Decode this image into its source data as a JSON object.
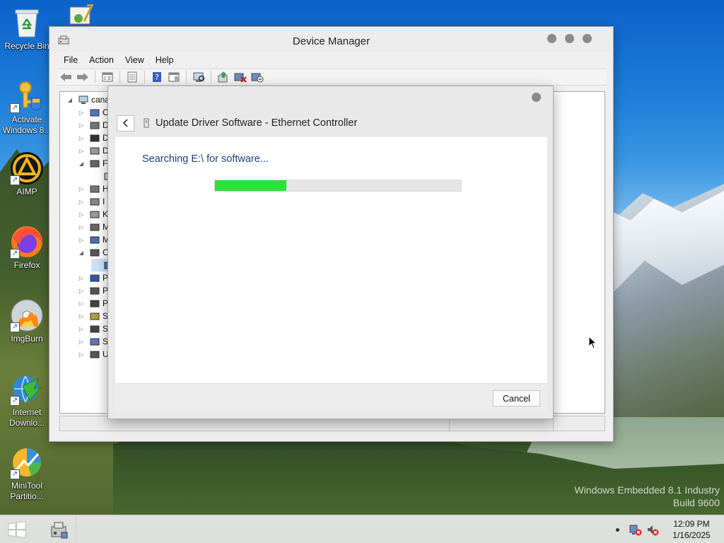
{
  "desktop": {
    "icons": [
      {
        "name": "recycle-bin-icon",
        "label": "Recycle Bin"
      },
      {
        "name": "activate-windows-icon",
        "label": "Activate Windows 8..."
      },
      {
        "name": "aimp-icon",
        "label": "AIMP"
      },
      {
        "name": "firefox-icon",
        "label": "Firefox"
      },
      {
        "name": "imgburn-icon",
        "label": "ImgBurn"
      },
      {
        "name": "internet-download-icon",
        "label": "Internet Downlo..."
      },
      {
        "name": "minitool-partition-icon",
        "label": "MiniTool Partitio..."
      }
    ],
    "watermark": {
      "line1": "Windows Embedded 8.1 Industry",
      "line2": "Build 9600"
    }
  },
  "device_manager": {
    "title": "Device Manager",
    "menu": [
      "File",
      "Action",
      "View",
      "Help"
    ],
    "toolbar": [
      "back-icon",
      "forward-icon",
      "properties-icon",
      "show-hide-icon",
      "help-icon",
      "action-view-icon",
      "scan-hardware-icon",
      "update-driver-icon",
      "uninstall-icon",
      "disable-icon"
    ],
    "tree": {
      "root": "cana",
      "items": [
        {
          "expand": "collapsed",
          "icon": "computer-icon",
          "label": "C"
        },
        {
          "expand": "collapsed",
          "icon": "disk-icon",
          "label": "D"
        },
        {
          "expand": "collapsed",
          "icon": "display-icon",
          "label": "D"
        },
        {
          "expand": "collapsed",
          "icon": "dvd-icon",
          "label": "D"
        },
        {
          "expand": "expanded",
          "icon": "floppy-icon",
          "label": "F"
        },
        {
          "expand": "none",
          "icon": "floppy-drive-icon",
          "label": ""
        },
        {
          "expand": "collapsed",
          "icon": "hid-icon",
          "label": "H"
        },
        {
          "expand": "collapsed",
          "icon": "ide-icon",
          "label": "I"
        },
        {
          "expand": "collapsed",
          "icon": "keyboard-icon",
          "label": "K"
        },
        {
          "expand": "collapsed",
          "icon": "mouse-icon",
          "label": "M"
        },
        {
          "expand": "collapsed",
          "icon": "monitor-icon",
          "label": "M"
        },
        {
          "expand": "expanded",
          "icon": "other-devices-icon",
          "label": "O"
        },
        {
          "expand": "none",
          "icon": "unknown-device-icon",
          "label": ""
        },
        {
          "expand": "collapsed",
          "icon": "ports-icon",
          "label": "P"
        },
        {
          "expand": "collapsed",
          "icon": "printer-icon",
          "label": "P"
        },
        {
          "expand": "collapsed",
          "icon": "processor-icon",
          "label": "P"
        },
        {
          "expand": "collapsed",
          "icon": "sound-icon",
          "label": "S"
        },
        {
          "expand": "collapsed",
          "icon": "storage-icon",
          "label": "S"
        },
        {
          "expand": "collapsed",
          "icon": "system-icon",
          "label": "S"
        },
        {
          "expand": "collapsed",
          "icon": "usb-icon",
          "label": "U"
        }
      ]
    }
  },
  "update_driver": {
    "title": "Update Driver Software - Ethernet Controller",
    "status_text": "Searching E:\\ for software...",
    "progress_fraction": 0.29,
    "cancel_label": "Cancel"
  },
  "taskbar": {
    "time": "12:09 PM",
    "date": "1/16/2025"
  },
  "colors": {
    "progress_fill": "#2ddf3b",
    "status_text": "#1f3f7a"
  }
}
